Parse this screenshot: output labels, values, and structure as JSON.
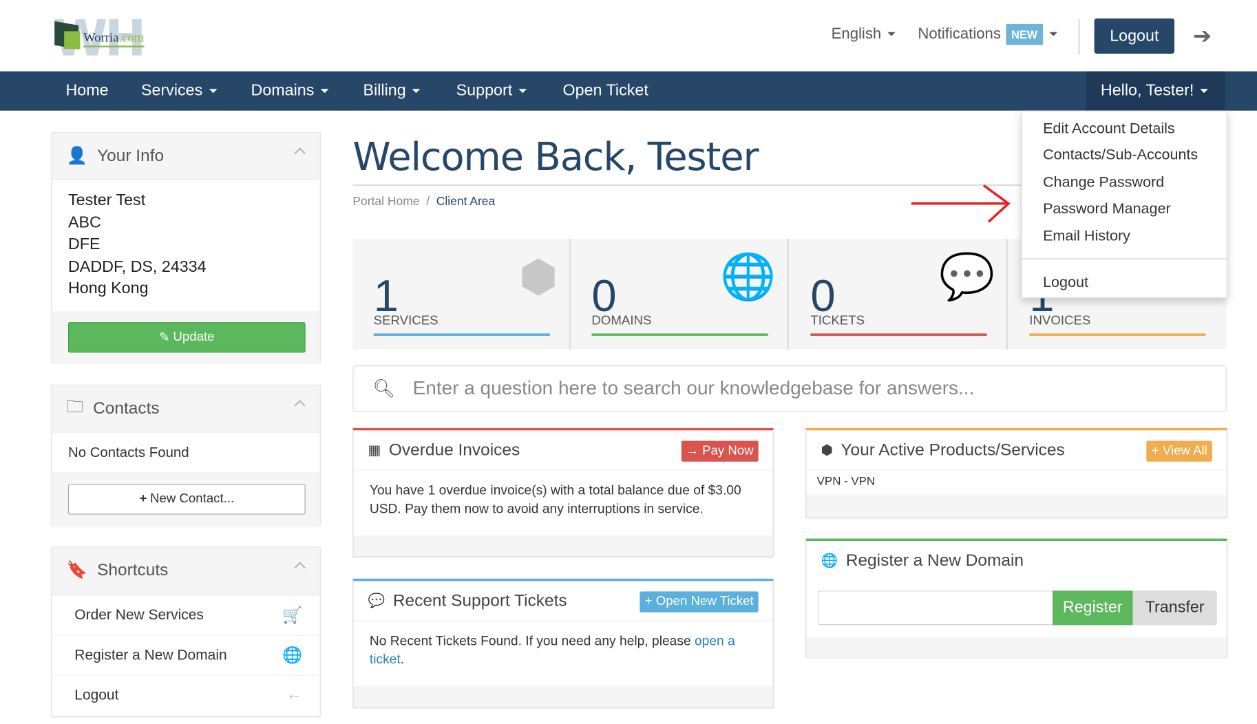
{
  "header": {
    "logo_text": "Worria",
    "logo_tld": ".com",
    "logo_letters": "WH",
    "language": "English",
    "notifications": "Notifications",
    "notifications_badge": "NEW",
    "logout": "Logout"
  },
  "nav": {
    "items": [
      "Home",
      "Services",
      "Domains",
      "Billing",
      "Support",
      "Open Ticket"
    ],
    "user": "Hello, Tester!"
  },
  "user_menu": {
    "items": [
      "Edit Account Details",
      "Contacts/Sub-Accounts",
      "Change Password",
      "Password Manager",
      "Email History"
    ],
    "logout": "Logout",
    "annotation_arrow_color": "#e8202a"
  },
  "sidebar": {
    "your_info": {
      "title": "Your Info",
      "lines": [
        "Tester Test",
        "ABC",
        "DFE",
        "DADDF, DS, 24334",
        "Hong Kong"
      ],
      "update": "Update"
    },
    "contacts": {
      "title": "Contacts",
      "empty": "No Contacts Found",
      "new": "New Contact..."
    },
    "shortcuts": {
      "title": "Shortcuts",
      "items": [
        "Order New Services",
        "Register a New Domain",
        "Logout"
      ]
    }
  },
  "main": {
    "title": "Welcome Back, Tester",
    "breadcrumb": [
      "Portal Home",
      "Client Area"
    ],
    "stats": [
      {
        "value": "1",
        "label": "SERVICES",
        "color": "#5bb0de"
      },
      {
        "value": "0",
        "label": "DOMAINS",
        "color": "#5cb85c"
      },
      {
        "value": "0",
        "label": "TICKETS",
        "color": "#d9534f"
      },
      {
        "value": "1",
        "label": "INVOICES",
        "color": "#f0ad4e"
      }
    ],
    "search_placeholder": "Enter a question here to search our knowledgebase for answers...",
    "overdue": {
      "title": "Overdue Invoices",
      "button": "Pay Now",
      "text": "You have 1 overdue invoice(s) with a total balance due of $3.00 USD. Pay them now to avoid any interruptions in service."
    },
    "tickets": {
      "title": "Recent Support Tickets",
      "button": "Open New Ticket",
      "text": "No Recent Tickets Found. If you need any help, please ",
      "link": "open a ticket",
      "after": "."
    },
    "products": {
      "title": "Your Active Products/Services",
      "button": "View All",
      "items": [
        "VPN - VPN"
      ]
    },
    "domain": {
      "title": "Register a New Domain",
      "register": "Register",
      "transfer": "Transfer"
    }
  }
}
